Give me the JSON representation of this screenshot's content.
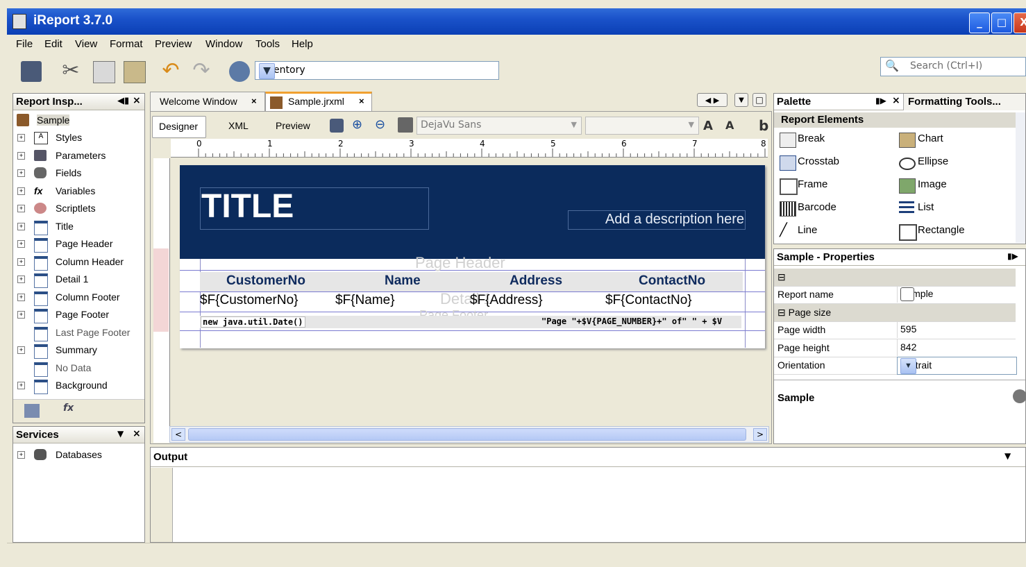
{
  "window": {
    "title": "iReport 3.7.0",
    "minimize": "_",
    "maximize": "□",
    "close": "X"
  },
  "menu": [
    "File",
    "Edit",
    "View",
    "Format",
    "Preview",
    "Window",
    "Tools",
    "Help"
  ],
  "toolbar": {
    "datasource_value": "inventory",
    "search_placeholder": "Search (Ctrl+I)"
  },
  "inspector": {
    "title": "Report Insp...",
    "root": "Sample",
    "items": [
      "Styles",
      "Parameters",
      "Fields",
      "Variables",
      "Scriptlets",
      "Title",
      "Page Header",
      "Column Header",
      "Detail 1",
      "Column Footer",
      "Page Footer",
      "Last Page Footer",
      "Summary",
      "No Data",
      "Background"
    ]
  },
  "services": {
    "title": "Services",
    "items": [
      "Databases"
    ]
  },
  "editor": {
    "tabs": [
      "Welcome Window",
      "Sample.jrxml"
    ],
    "subtabs": [
      "Designer",
      "XML",
      "Preview"
    ],
    "font": "DejaVu Sans",
    "ruler_marks": [
      "0",
      "1",
      "2",
      "3",
      "4",
      "5",
      "6",
      "7",
      "8"
    ]
  },
  "report": {
    "title": "TITLE",
    "description": "Add a description here",
    "page_header_ghost": "Page Header",
    "detail_ghost": "Detail 1",
    "page_footer_ghost": "Page Footer",
    "columns": [
      "CustomerNo",
      "Name",
      "Address",
      "ContactNo"
    ],
    "fields": [
      "$F{CustomerNo}",
      "$F{Name}",
      "$F{Address}",
      "$F{ContactNo}"
    ],
    "footer_left": "new java.util.Date()",
    "footer_right": "\"Page \"+$V{PAGE_NUMBER}+\" of\" \" + $V"
  },
  "palette": {
    "title": "Palette",
    "other_tab": "Formatting Tools...",
    "group": "Report Elements",
    "items": [
      "Break",
      "Chart",
      "Crosstab",
      "Ellipse",
      "Frame",
      "Image",
      "Barcode",
      "List",
      "Line",
      "Rectangle"
    ]
  },
  "properties": {
    "title": "Sample - Properties",
    "report_name_label": "Report name",
    "report_name": "Sample",
    "page_size_label": "Page size",
    "page_width_label": "Page width",
    "page_width": "595",
    "page_height_label": "Page height",
    "page_height": "842",
    "orientation_label": "Orientation",
    "orientation": "Portrait",
    "footer_name": "Sample"
  },
  "output": {
    "title": "Output"
  },
  "colors": {
    "title_band": "#0b2b5c",
    "titlebar": "#1a52c9",
    "chrome": "#ece9d8"
  }
}
